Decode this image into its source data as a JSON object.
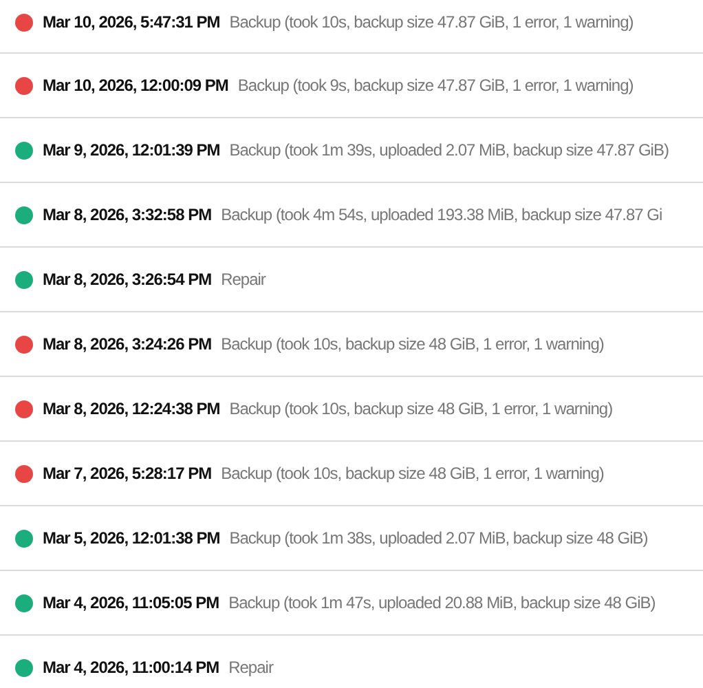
{
  "events": [
    {
      "color": "#e84545",
      "time": "Mar 10, 2026, 5:47:31 PM",
      "description": "Backup (took 10s, backup size 47.87 GiB, 1 error, 1 warning)"
    },
    {
      "color": "#e84545",
      "time": "Mar 10, 2026, 12:00:09 PM",
      "description": "Backup (took 9s, backup size 47.87 GiB, 1 error, 1 warning)"
    },
    {
      "color": "#1cad7c",
      "time": "Mar 9, 2026, 12:01:39 PM",
      "description": "Backup (took 1m 39s, uploaded 2.07 MiB, backup size 47.87 GiB)"
    },
    {
      "color": "#1cad7c",
      "time": "Mar 8, 2026, 3:32:58 PM",
      "description": "Backup (took 4m 54s, uploaded 193.38 MiB, backup size 47.87 Gi"
    },
    {
      "color": "#1cad7c",
      "time": "Mar 8, 2026, 3:26:54 PM",
      "description": "Repair"
    },
    {
      "color": "#e84545",
      "time": "Mar 8, 2026, 3:24:26 PM",
      "description": "Backup (took 10s, backup size 48 GiB, 1 error, 1 warning)"
    },
    {
      "color": "#e84545",
      "time": "Mar 8, 2026, 12:24:38 PM",
      "description": "Backup (took 10s, backup size 48 GiB, 1 error, 1 warning)"
    },
    {
      "color": "#e84545",
      "time": "Mar 7, 2026, 5:28:17 PM",
      "description": "Backup (took 10s, backup size 48 GiB, 1 error, 1 warning)"
    },
    {
      "color": "#1cad7c",
      "time": "Mar 5, 2026, 12:01:38 PM",
      "description": "Backup (took 1m 38s, uploaded 2.07 MiB, backup size 48 GiB)"
    },
    {
      "color": "#1cad7c",
      "time": "Mar 4, 2026, 11:05:05 PM",
      "description": "Backup (took 1m 47s, uploaded 20.88 MiB, backup size 48 GiB)"
    },
    {
      "color": "#1cad7c",
      "time": "Mar 4, 2026, 11:00:14 PM",
      "description": "Repair"
    }
  ]
}
